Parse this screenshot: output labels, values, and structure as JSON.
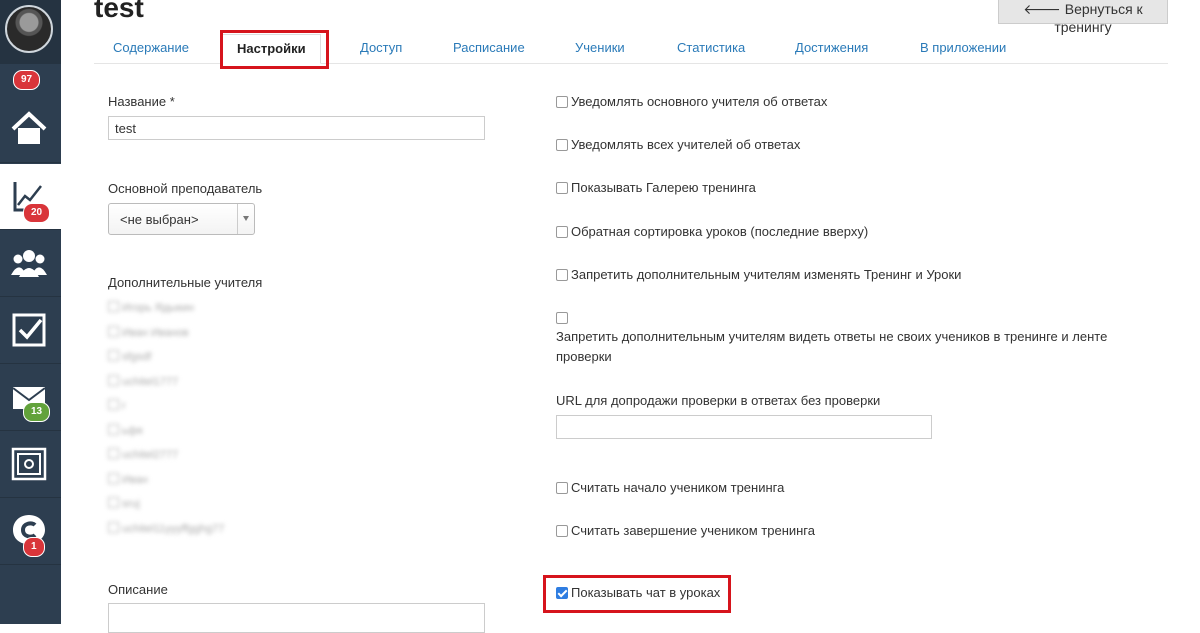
{
  "page": {
    "title": "test",
    "back_button": "Вернуться к тренингу"
  },
  "sidebar": {
    "badges": {
      "avatar": "97",
      "training": "20",
      "messages": "13",
      "chat": "1"
    },
    "items": [
      {
        "icon": "home-icon"
      },
      {
        "icon": "chart-icon"
      },
      {
        "icon": "users-icon"
      },
      {
        "icon": "checkbox-icon"
      },
      {
        "icon": "mail-icon"
      },
      {
        "icon": "safe-icon"
      },
      {
        "icon": "chat-icon"
      }
    ]
  },
  "tabs": [
    "Содержание",
    "Настройки",
    "Доступ",
    "Расписание",
    "Ученики",
    "Статистика",
    "Достижения",
    "В приложении"
  ],
  "form": {
    "name_label": "Название *",
    "name_value": "test",
    "teacher_label": "Основной преподаватель",
    "teacher_value": "<не выбран>",
    "extra_teachers_label": "Дополнительные учителя",
    "extra_teachers": [
      "Игорь Ядыкин",
      "Иван Иванов",
      "sfgsdf",
      "uchitel1777",
      "r",
      "ьфя",
      "uchitel2777",
      "Иван",
      "sruj",
      "uchitel11yyyffgghg77"
    ],
    "description_label": "Описание"
  },
  "options": {
    "notify_main": "Уведомлять основного учителя об ответах",
    "notify_all": "Уведомлять всех учителей об ответах",
    "show_gallery": "Показывать Галерею тренинга",
    "reverse_sort": "Обратная сортировка уроков (последние вверху)",
    "forbid_edit": "Запретить дополнительным учителям изменять Тренинг и Уроки",
    "forbid_view": "Запретить дополнительным учителям видеть ответы не своих учеников в тренинге и ленте проверки",
    "url_label": "URL для допродажи проверки в ответах без проверки",
    "count_start": "Считать начало учеником тренинга",
    "count_end": "Считать завершение учеником тренинга",
    "show_chat": "Показывать чат в уроках"
  },
  "colors": {
    "sidebar": "#2d3e50",
    "highlight": "#d6141c",
    "link": "#2a7ab8",
    "checked": "#2f7de1"
  }
}
